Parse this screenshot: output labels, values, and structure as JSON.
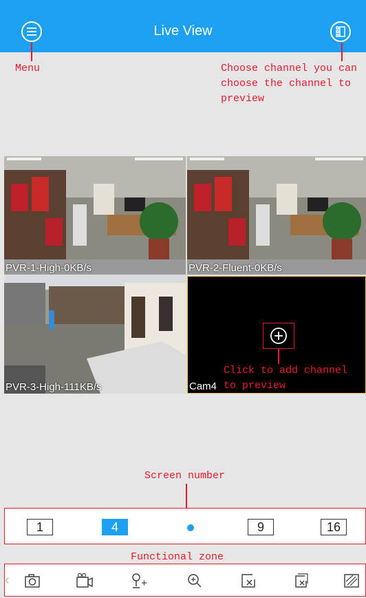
{
  "header": {
    "title": "Live View",
    "background": "#1ea0f2"
  },
  "annotations": {
    "menu": "Menu",
    "choose_channel": "Choose channel you can\nchoose the channel to\npreview",
    "add_channel": "Click to add channel\nto preview",
    "screen_number": "Screen number",
    "functional_zone": "Functional zone",
    "color": "#e8192c"
  },
  "tiles": [
    {
      "label": "PVR-1-High-0KB/s"
    },
    {
      "label": "PVR-2-Fluent-0KB/s"
    },
    {
      "label": "PVR-3-High-111KB/s"
    },
    {
      "label": "Cam4"
    }
  ],
  "screen_options": [
    "1",
    "4",
    "9",
    "16"
  ],
  "selected_screen": "4",
  "tools": [
    "camera-icon",
    "record-icon",
    "ptz-icon",
    "zoom-in-icon",
    "close-channel-icon",
    "close-all-icon",
    "stretch-icon"
  ]
}
